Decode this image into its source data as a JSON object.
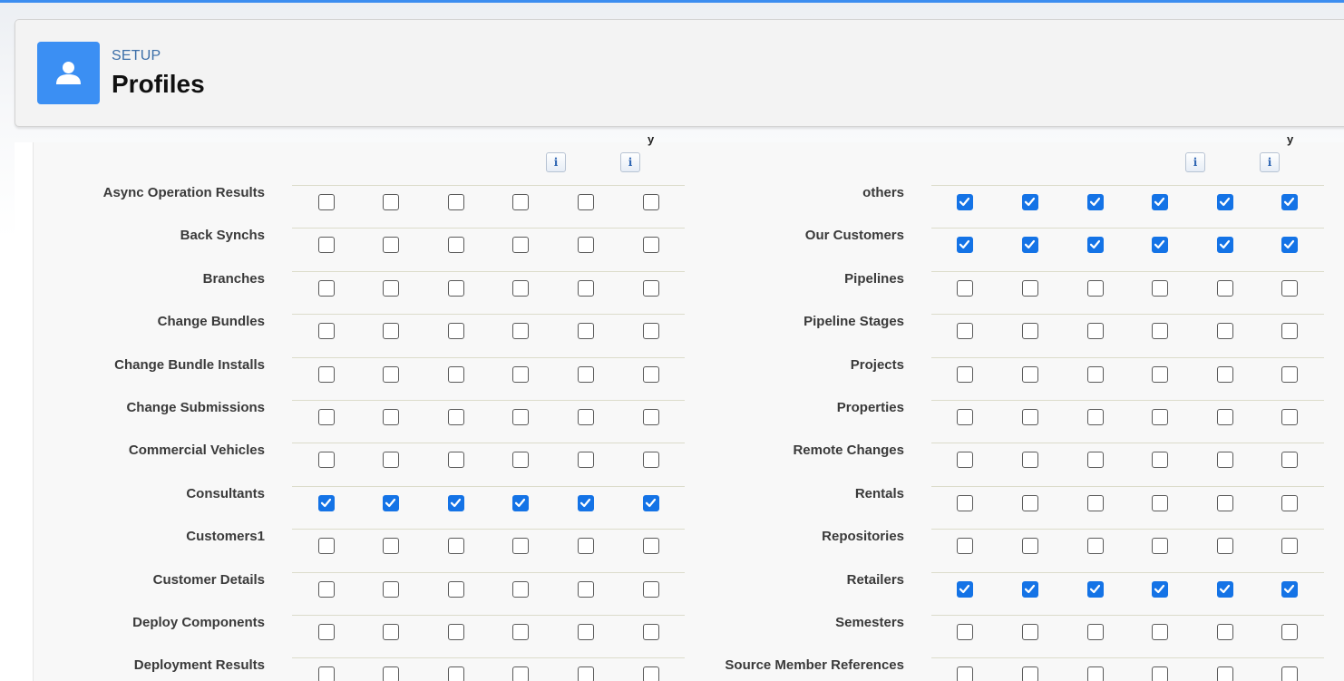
{
  "header": {
    "breadcrumb": "SETUP",
    "title": "Profiles",
    "icon": "user-profile-icon",
    "accent": "#3b8ff3"
  },
  "info_button_glyph": "i",
  "column_header_fragment": "y",
  "left_table": {
    "rows": [
      {
        "label": "Async Operation Results",
        "checked": [
          false,
          false,
          false,
          false,
          false,
          false
        ]
      },
      {
        "label": "Back Synchs",
        "checked": [
          false,
          false,
          false,
          false,
          false,
          false
        ]
      },
      {
        "label": "Branches",
        "checked": [
          false,
          false,
          false,
          false,
          false,
          false
        ]
      },
      {
        "label": "Change Bundles",
        "checked": [
          false,
          false,
          false,
          false,
          false,
          false
        ]
      },
      {
        "label": "Change Bundle Installs",
        "checked": [
          false,
          false,
          false,
          false,
          false,
          false
        ]
      },
      {
        "label": "Change Submissions",
        "checked": [
          false,
          false,
          false,
          false,
          false,
          false
        ]
      },
      {
        "label": "Commercial Vehicles",
        "checked": [
          false,
          false,
          false,
          false,
          false,
          false
        ]
      },
      {
        "label": "Consultants",
        "checked": [
          true,
          true,
          true,
          true,
          true,
          true
        ]
      },
      {
        "label": "Customers1",
        "checked": [
          false,
          false,
          false,
          false,
          false,
          false
        ]
      },
      {
        "label": "Customer Details",
        "checked": [
          false,
          false,
          false,
          false,
          false,
          false
        ]
      },
      {
        "label": "Deploy Components",
        "checked": [
          false,
          false,
          false,
          false,
          false,
          false
        ]
      },
      {
        "label": "Deployment Results",
        "checked": [
          false,
          false,
          false,
          false,
          false,
          false
        ]
      }
    ]
  },
  "right_table": {
    "rows": [
      {
        "label": "others",
        "checked": [
          true,
          true,
          true,
          true,
          true,
          true
        ]
      },
      {
        "label": "Our Customers",
        "checked": [
          true,
          true,
          true,
          true,
          true,
          true
        ]
      },
      {
        "label": "Pipelines",
        "checked": [
          false,
          false,
          false,
          false,
          false,
          false
        ]
      },
      {
        "label": "Pipeline Stages",
        "checked": [
          false,
          false,
          false,
          false,
          false,
          false
        ]
      },
      {
        "label": "Projects",
        "checked": [
          false,
          false,
          false,
          false,
          false,
          false
        ]
      },
      {
        "label": "Properties",
        "checked": [
          false,
          false,
          false,
          false,
          false,
          false
        ]
      },
      {
        "label": "Remote Changes",
        "checked": [
          false,
          false,
          false,
          false,
          false,
          false
        ]
      },
      {
        "label": "Rentals",
        "checked": [
          false,
          false,
          false,
          false,
          false,
          false
        ]
      },
      {
        "label": "Repositories",
        "checked": [
          false,
          false,
          false,
          false,
          false,
          false
        ]
      },
      {
        "label": "Retailers",
        "checked": [
          true,
          true,
          true,
          true,
          true,
          true
        ]
      },
      {
        "label": "Semesters",
        "checked": [
          false,
          false,
          false,
          false,
          false,
          false
        ]
      },
      {
        "label": "Source Member References",
        "checked": [
          false,
          false,
          false,
          false,
          false,
          false
        ]
      }
    ]
  }
}
